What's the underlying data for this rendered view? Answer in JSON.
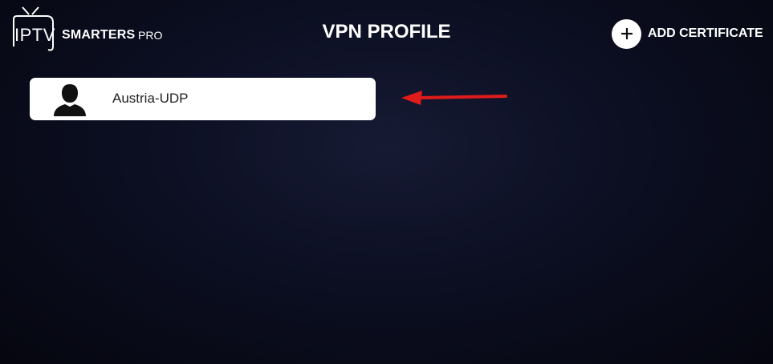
{
  "header": {
    "logo": {
      "iptv": "IPTV",
      "smarters": "SMARTERS",
      "pro": "PRO"
    },
    "title": "VPN PROFILE",
    "add_certificate": {
      "icon": "plus-icon",
      "label": "ADD CERTIFICATE"
    }
  },
  "profiles": [
    {
      "name": "Austria-UDP",
      "icon": "user-icon"
    }
  ],
  "annotation": {
    "icon": "arrow-left-icon",
    "color": "#e01b1b"
  },
  "colors": {
    "background": "#0c0f22",
    "card": "#ffffff",
    "text": "#ffffff"
  }
}
